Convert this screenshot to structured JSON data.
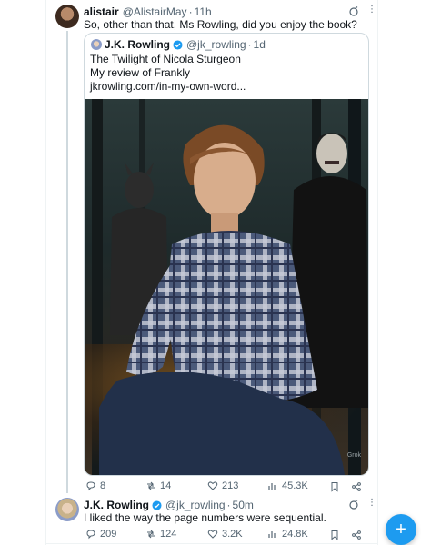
{
  "reply_tweet": {
    "name": "alistair",
    "handle": "@AlistairMay",
    "time": "11h",
    "text": "So, other than that, Ms Rowling, did you enjoy the book?",
    "actions": {
      "replies": "8",
      "reposts": "14",
      "likes": "213",
      "views": "45.3K"
    }
  },
  "quoted_tweet": {
    "name": "J.K. Rowling",
    "handle": "@jk_rowling",
    "time": "1d",
    "lines": [
      "The Twilight of Nicola Sturgeon",
      "My review of Frankly",
      "jkrowling.com/in-my-own-word..."
    ],
    "image_label": "Grok"
  },
  "author_reply": {
    "name": "J.K. Rowling",
    "handle": "@jk_rowling",
    "time": "50m",
    "text": "I liked the way the page numbers were sequential.",
    "actions": {
      "replies": "209",
      "reposts": "124",
      "likes": "3.2K",
      "views": "24.8K"
    }
  },
  "separator": "·",
  "fab_label": "+",
  "colors": {
    "accent": "#1d9bf0",
    "muted": "#536471",
    "text": "#0f1419",
    "border": "#cfd9de"
  },
  "icons": [
    "reply-icon",
    "repost-icon",
    "like-icon",
    "views-icon",
    "bookmark-icon",
    "share-icon",
    "verified-icon",
    "grok-icon",
    "more-icon",
    "compose-icon"
  ]
}
